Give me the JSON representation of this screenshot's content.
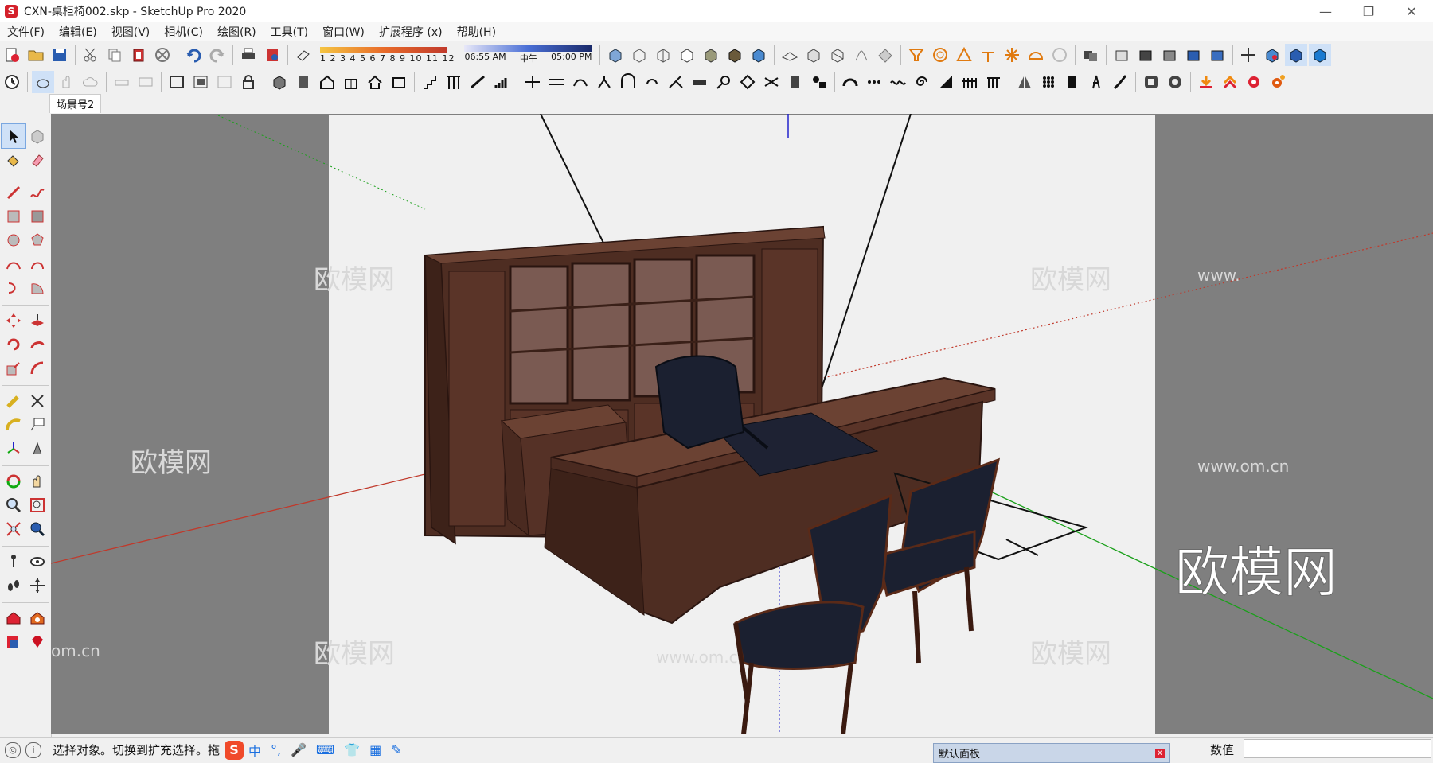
{
  "window": {
    "title": "CXN-桌柜椅002.skp - SketchUp Pro 2020",
    "minimize": "—",
    "restore": "❐",
    "close": "✕"
  },
  "menu": [
    "文件(F)",
    "编辑(E)",
    "视图(V)",
    "相机(C)",
    "绘图(R)",
    "工具(T)",
    "窗口(W)",
    "扩展程序 (x)",
    "帮助(H)"
  ],
  "shadow_months": "1 2 3 4 5 6 7 8 9 10 11 12",
  "shadow_time": {
    "start": "06:55 AM",
    "mid": "中午",
    "end": "05:00 PM"
  },
  "scenes": [
    "场景号2"
  ],
  "status": {
    "message": "选择对象。切换到扩充选择。拖",
    "ime_logo": "S",
    "ime_items": [
      "中",
      "°,",
      "🎤",
      "⌨",
      "👕",
      "▦",
      "✎"
    ]
  },
  "panel": {
    "title": "默认面板",
    "close": "x"
  },
  "measurement": {
    "label": "数值",
    "value": ""
  },
  "watermark": {
    "text": "欧模网",
    "url": "www.om.cn",
    "url_fragment": "om.cn",
    "url_prefix": "www."
  },
  "colors": {
    "wood_dark": "#4a2a20",
    "wood_mid": "#5a3428",
    "wood_light": "#6b4233",
    "chair": "#1b2030",
    "canvas": "#f0f0f0",
    "void": "#7f7f7f",
    "axis_red": "#c0392b",
    "axis_green": "#1aa01a",
    "axis_blue": "#2222cc"
  }
}
